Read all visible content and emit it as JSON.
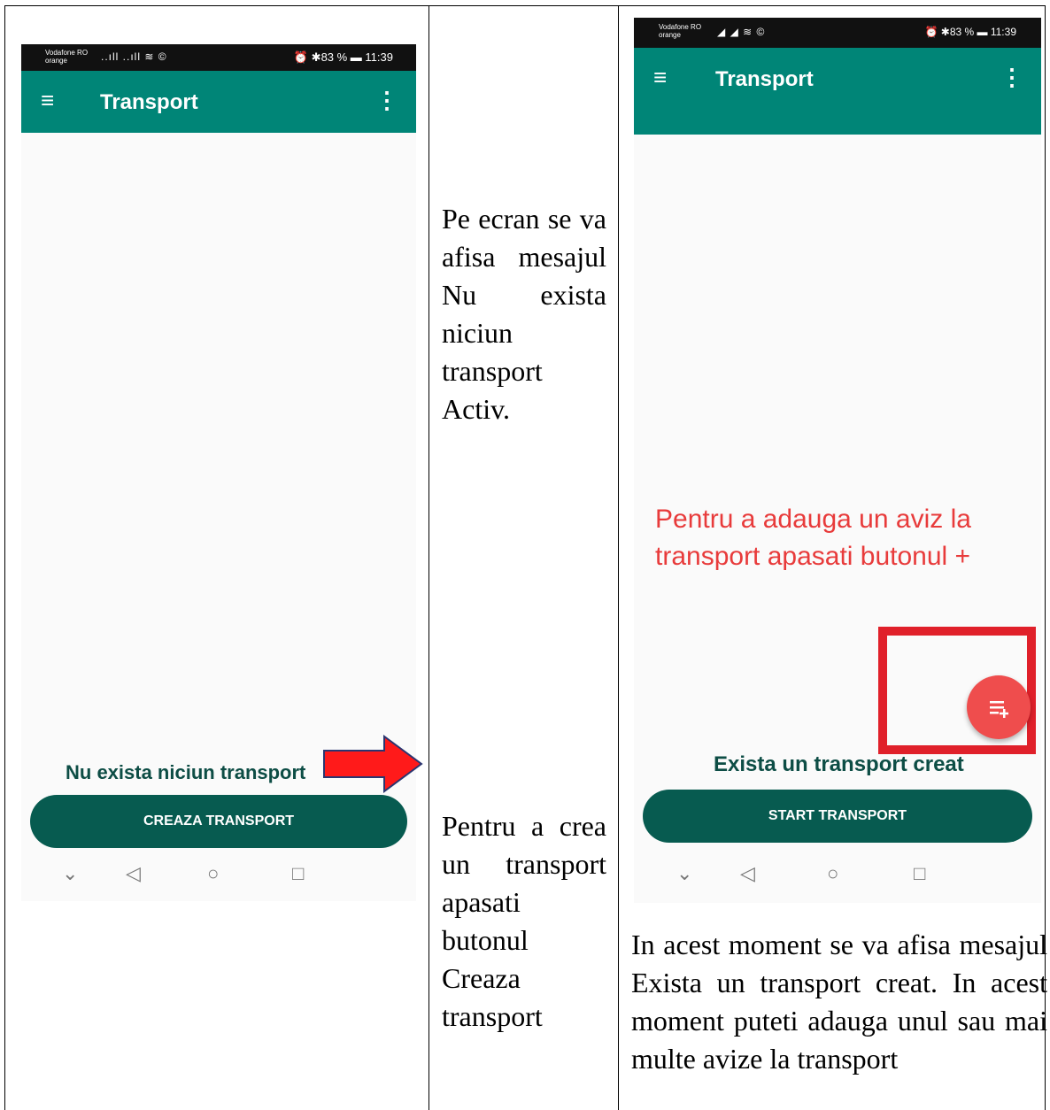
{
  "phone1": {
    "status": {
      "carrier_line1": "Vodafone RO",
      "carrier_line2": "orange",
      "signal": "..ıll ..ıll ≋ ©",
      "right": "⏰ ✱83 % ▬ 11:39"
    },
    "appbar": {
      "menu_icon": "hamburger-icon",
      "title": "Transport",
      "more_icon": "overflow-icon"
    },
    "message": "Nu exista niciun transport",
    "button": "CREAZA TRANSPORT"
  },
  "middle": {
    "text1": "Pe ecran se va afisa mesajul Nu exista niciun transport Activ.",
    "text2": "Pentru a crea un transport apasati butonul Creaza transport"
  },
  "phone2": {
    "status": {
      "carrier_line1": "Vodafone RO",
      "carrier_line2": "orange",
      "signal": "◢ ◢ ≋ ©",
      "right": "⏰ ✱83 % ▬ 11:39"
    },
    "appbar": {
      "menu_icon": "hamburger-icon",
      "title": "Transport",
      "more_icon": "overflow-icon"
    },
    "hint": "Pentru a adauga un aviz la transport apasati butonul +",
    "message": "Exista un transport creat",
    "button": "START TRANSPORT"
  },
  "bottom_text": "In acest moment se va afisa mesajul Exista un transport creat. In acest moment puteti adauga unul sau mai multe avize la transport",
  "colors": {
    "appbar": "#008577",
    "button": "#075b50",
    "fab": "#ef4d4d",
    "highlight": "#e0202a",
    "hint": "#e83b3b"
  }
}
